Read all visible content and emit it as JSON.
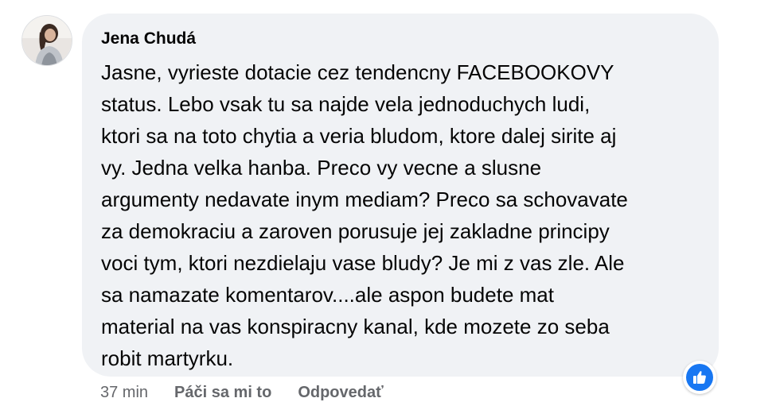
{
  "comment": {
    "author": "Jena Chudá",
    "text_lines": [
      "Jasne, vyrieste dotacie cez tendencny FACEBOOKOVY",
      "status. Lebo vsak tu sa najde vela jednoduchych ludi,",
      "ktori sa na toto chytia a veria bludom, ktore dalej sirite aj",
      "vy. Jedna velka hanba. Preco vy vecne a slusne",
      "argumenty nedavate inym mediam? Preco sa schovavate",
      "za demokraciu a zaroven porusuje jej zakladne principy",
      "voci tym, ktori nezdielaju vase bludy? Je mi z vas zle. Ale",
      "sa namazate komentarov....ale aspon budete mat",
      "material na vas konspiracny kanal, kde mozete zo seba",
      "robit martyrku."
    ],
    "avatar_icon": "user-avatar-photo",
    "reaction_icon": "thumbs-up-icon",
    "reaction_color": "#1877f2"
  },
  "actions": {
    "time": "37 min",
    "like_label": "Páči sa mi to",
    "reply_label": "Odpovedať"
  }
}
